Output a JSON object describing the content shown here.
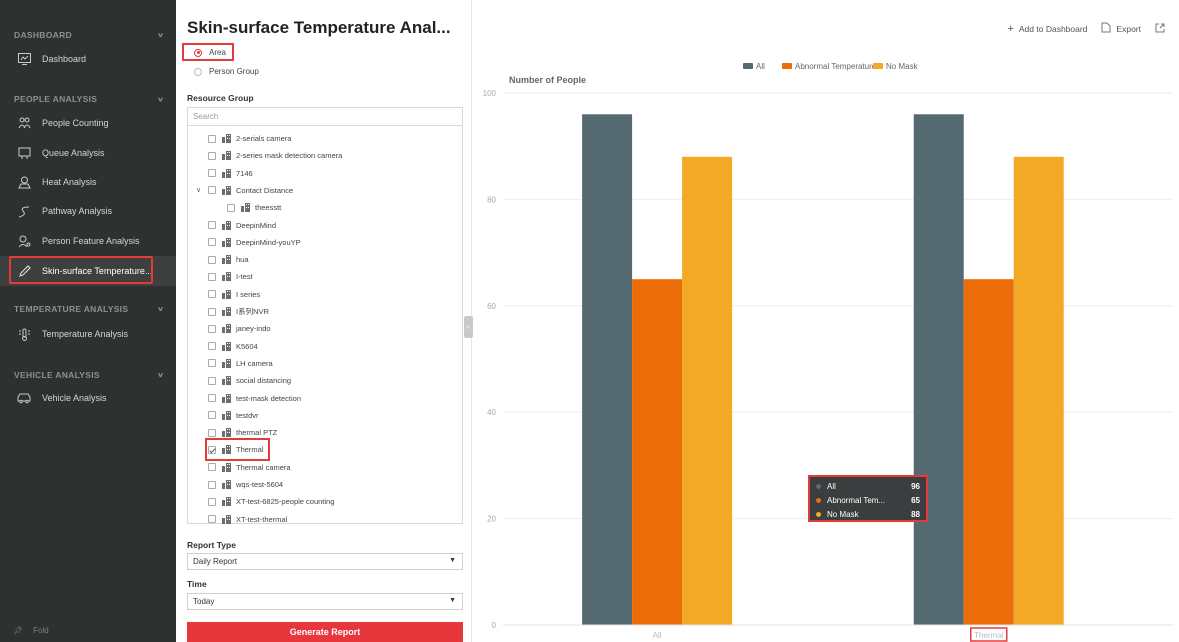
{
  "sidebar": {
    "sections": [
      {
        "title": "DASHBOARD",
        "items": [
          {
            "label": "Dashboard",
            "icon": "dashboard-icon"
          }
        ]
      },
      {
        "title": "PEOPLE ANALYSIS",
        "items": [
          {
            "label": "People Counting",
            "icon": "people-counting-icon"
          },
          {
            "label": "Queue Analysis",
            "icon": "queue-icon"
          },
          {
            "label": "Heat Analysis",
            "icon": "heat-icon"
          },
          {
            "label": "Pathway Analysis",
            "icon": "pathway-icon"
          },
          {
            "label": "Person Feature Analysis",
            "icon": "person-feature-icon"
          },
          {
            "label": "Skin-surface Temperature...",
            "icon": "pen-icon",
            "active": true
          }
        ]
      },
      {
        "title": "TEMPERATURE ANALYSIS",
        "items": [
          {
            "label": "Temperature Analysis",
            "icon": "thermometer-icon"
          }
        ]
      },
      {
        "title": "VEHICLE ANALYSIS",
        "items": [
          {
            "label": "Vehicle Analysis",
            "icon": "vehicle-icon"
          }
        ]
      }
    ],
    "fold_label": "Fold"
  },
  "panel": {
    "title": "Skin-surface Temperature Anal...",
    "radio_area": "Area",
    "radio_person_group": "Person Group",
    "resource_group_label": "Resource Group",
    "search_placeholder": "Search",
    "tree": [
      {
        "label": "2-serials camera",
        "checked": false
      },
      {
        "label": "2-series mask detection camera",
        "checked": false
      },
      {
        "label": "7146",
        "checked": false
      },
      {
        "label": "Contact Distance",
        "checked": false,
        "expanded": true
      },
      {
        "label": "theesstt",
        "checked": false,
        "child": true
      },
      {
        "label": "DeepinMind",
        "checked": false
      },
      {
        "label": "DeepinMind-youYP",
        "checked": false
      },
      {
        "label": "hua",
        "checked": false
      },
      {
        "label": "I-test",
        "checked": false
      },
      {
        "label": "I series",
        "checked": false
      },
      {
        "label": "I系列NVR",
        "checked": false
      },
      {
        "label": "janey-indo",
        "checked": false
      },
      {
        "label": "K5604",
        "checked": false
      },
      {
        "label": "LH camera",
        "checked": false
      },
      {
        "label": "social distancing",
        "checked": false
      },
      {
        "label": "test-mask detection",
        "checked": false
      },
      {
        "label": "testdvr",
        "checked": false
      },
      {
        "label": "thermal PTZ",
        "checked": false
      },
      {
        "label": "Thermal",
        "checked": true
      },
      {
        "label": "Thermal camera",
        "checked": false
      },
      {
        "label": "wqs-test-5604",
        "checked": false
      },
      {
        "label": "XT-test-6825-people counting",
        "checked": false
      },
      {
        "label": "XT-test-thermal",
        "checked": false
      }
    ],
    "report_type_label": "Report Type",
    "report_type_value": "Daily Report",
    "time_label": "Time",
    "time_value": "Today",
    "generate_button": "Generate Report"
  },
  "toolbar": {
    "add_dashboard": "Add to Dashboard",
    "export": "Export"
  },
  "tooltip": {
    "rows": [
      {
        "name": "All",
        "value": "96",
        "color": "#5a6b73"
      },
      {
        "name": "Abnormal Tem...",
        "value": "65",
        "color": "#ec6c0a"
      },
      {
        "name": "No Mask",
        "value": "88",
        "color": "#f3a826"
      }
    ]
  },
  "colors": {
    "accent": "#e53a3a",
    "all": "#556970",
    "abnormal": "#ec6c0a",
    "nomask": "#f3a826"
  },
  "chart_data": {
    "type": "bar",
    "ylabel": "Number of People",
    "categories": [
      "All",
      "Thermal"
    ],
    "series": [
      {
        "name": "All",
        "values": [
          96,
          96
        ],
        "color": "#556970"
      },
      {
        "name": "Abnormal Temperature",
        "values": [
          65,
          65
        ],
        "color": "#ec6c0a"
      },
      {
        "name": "No Mask",
        "values": [
          88,
          88
        ],
        "color": "#f3a826"
      }
    ],
    "yticks": [
      0,
      20,
      40,
      60,
      80,
      100
    ],
    "ylim": [
      0,
      100
    ],
    "legend": "top-center",
    "grid": true
  }
}
